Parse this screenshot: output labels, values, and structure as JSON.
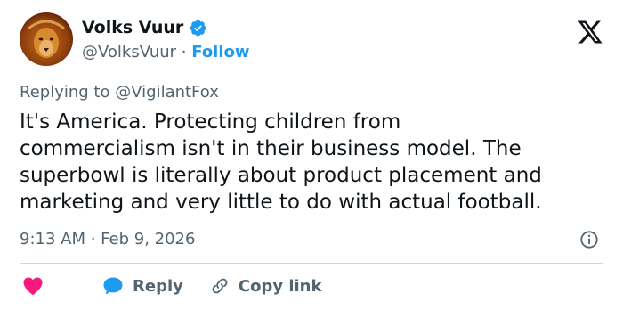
{
  "author": {
    "name": "Volks Vuur",
    "handle": "@VolksVuur",
    "separator": "·",
    "follow_label": "Follow",
    "verified_color": "#1d9bf0"
  },
  "icons": {
    "avatar": "lion-avatar",
    "verified": "verified-badge-icon",
    "brand": "x-logo-icon",
    "info": "info-icon",
    "like": "heart-icon",
    "reply": "reply-bubble-icon",
    "copy": "link-icon"
  },
  "reply_context": {
    "prefix": "Replying to",
    "mention": "@VigilantFox"
  },
  "tweet": {
    "lines": [
      "It's America. Protecting children from",
      "commercialism isn't in their business model. The",
      "superbowl is literally about product placement and",
      "marketing and very little to do with actual football."
    ],
    "timestamp": "9:13 AM · Feb 9, 2026"
  },
  "actions": {
    "reply_label": "Reply",
    "copy_link_label": "Copy link"
  },
  "colors": {
    "accent": "#1d9bf0",
    "heart": "#f91880",
    "muted_text": "#536471",
    "primary_text": "#0f1419"
  }
}
